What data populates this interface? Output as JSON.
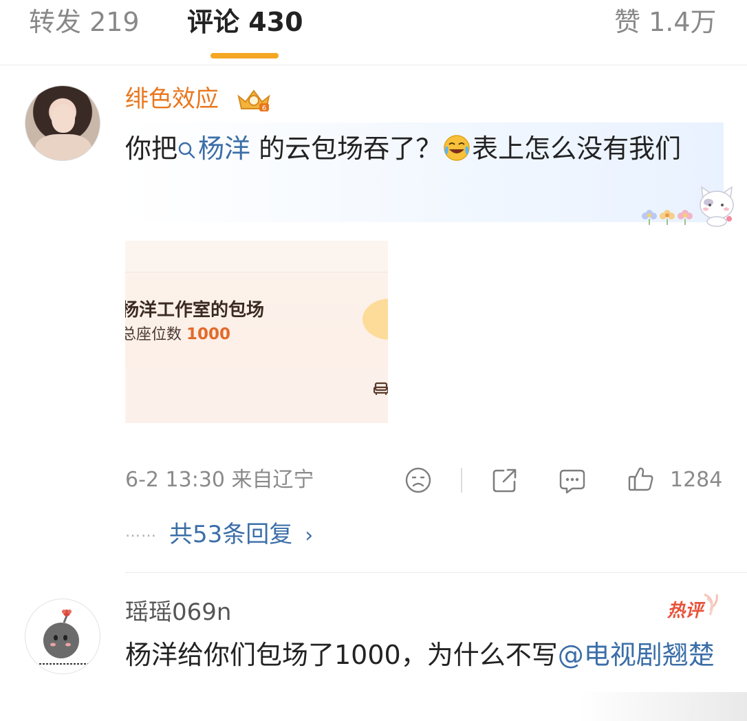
{
  "tabs": {
    "repost": "转发 219",
    "comments": "评论 430",
    "likes": "赞 1.4万"
  },
  "comment1": {
    "username": "绯色效应",
    "text_before": "你把",
    "topic": "杨洋",
    "text_middle": " 的云包场吞了？",
    "text_after": "表上怎么没有我们",
    "attachment": {
      "line1": "杨洋工作室的包场",
      "line2_label": "总座位数 ",
      "line2_value": "1000"
    },
    "meta": "6-2 13:30 来自辽宁",
    "like_count": "1284",
    "replies_dots": "……",
    "replies_text": "共53条回复",
    "replies_chevron": "›"
  },
  "comment2": {
    "username": "瑶瑶069n",
    "hot_badge": "热评",
    "text_before": "杨洋给你们包场了1000，为什么不写",
    "mention": "@电视剧翘楚"
  },
  "colors": {
    "accent_orange": "#f5a623",
    "username_orange": "#e8771e",
    "link_blue": "#3b6ea8",
    "hot_red": "#e8523a"
  },
  "icons": {
    "sad": "sad-face-icon",
    "share": "share-icon",
    "comment": "comment-icon",
    "like": "thumbs-up-icon"
  }
}
